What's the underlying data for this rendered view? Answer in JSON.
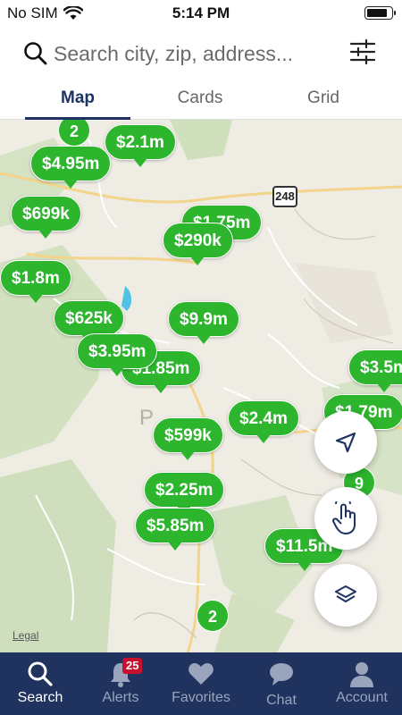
{
  "status_bar": {
    "carrier": "No SIM",
    "time": "5:14 PM"
  },
  "search": {
    "placeholder": "Search city, zip, address..."
  },
  "tabs": [
    {
      "label": "Map",
      "active": true
    },
    {
      "label": "Cards",
      "active": false
    },
    {
      "label": "Grid",
      "active": false
    }
  ],
  "map": {
    "road_shield": "248",
    "town_label_fragment": "P",
    "legal_link": "Legal",
    "markers": [
      "$2.1m",
      "$4.95m",
      "$699k",
      "$1.75m",
      "$290k",
      "$1.8m",
      "$625k",
      "$9.9m",
      "$3.95m",
      "$1.85m",
      "$3.5m",
      "$1.79m",
      "$2.4m",
      "$599k",
      "$2.25m",
      "$5.85m",
      "$11.5m"
    ],
    "clusters": [
      "2",
      "9",
      "2"
    ]
  },
  "bottom_nav": {
    "items": [
      {
        "label": "Search",
        "active": true
      },
      {
        "label": "Alerts",
        "badge": "25"
      },
      {
        "label": "Favorites"
      },
      {
        "label": "Chat"
      },
      {
        "label": "Account"
      }
    ]
  },
  "colors": {
    "marker_green": "#2db52d",
    "nav_bg": "#20335e",
    "accent_navy": "#1e3264",
    "badge_red": "#c8102e"
  }
}
